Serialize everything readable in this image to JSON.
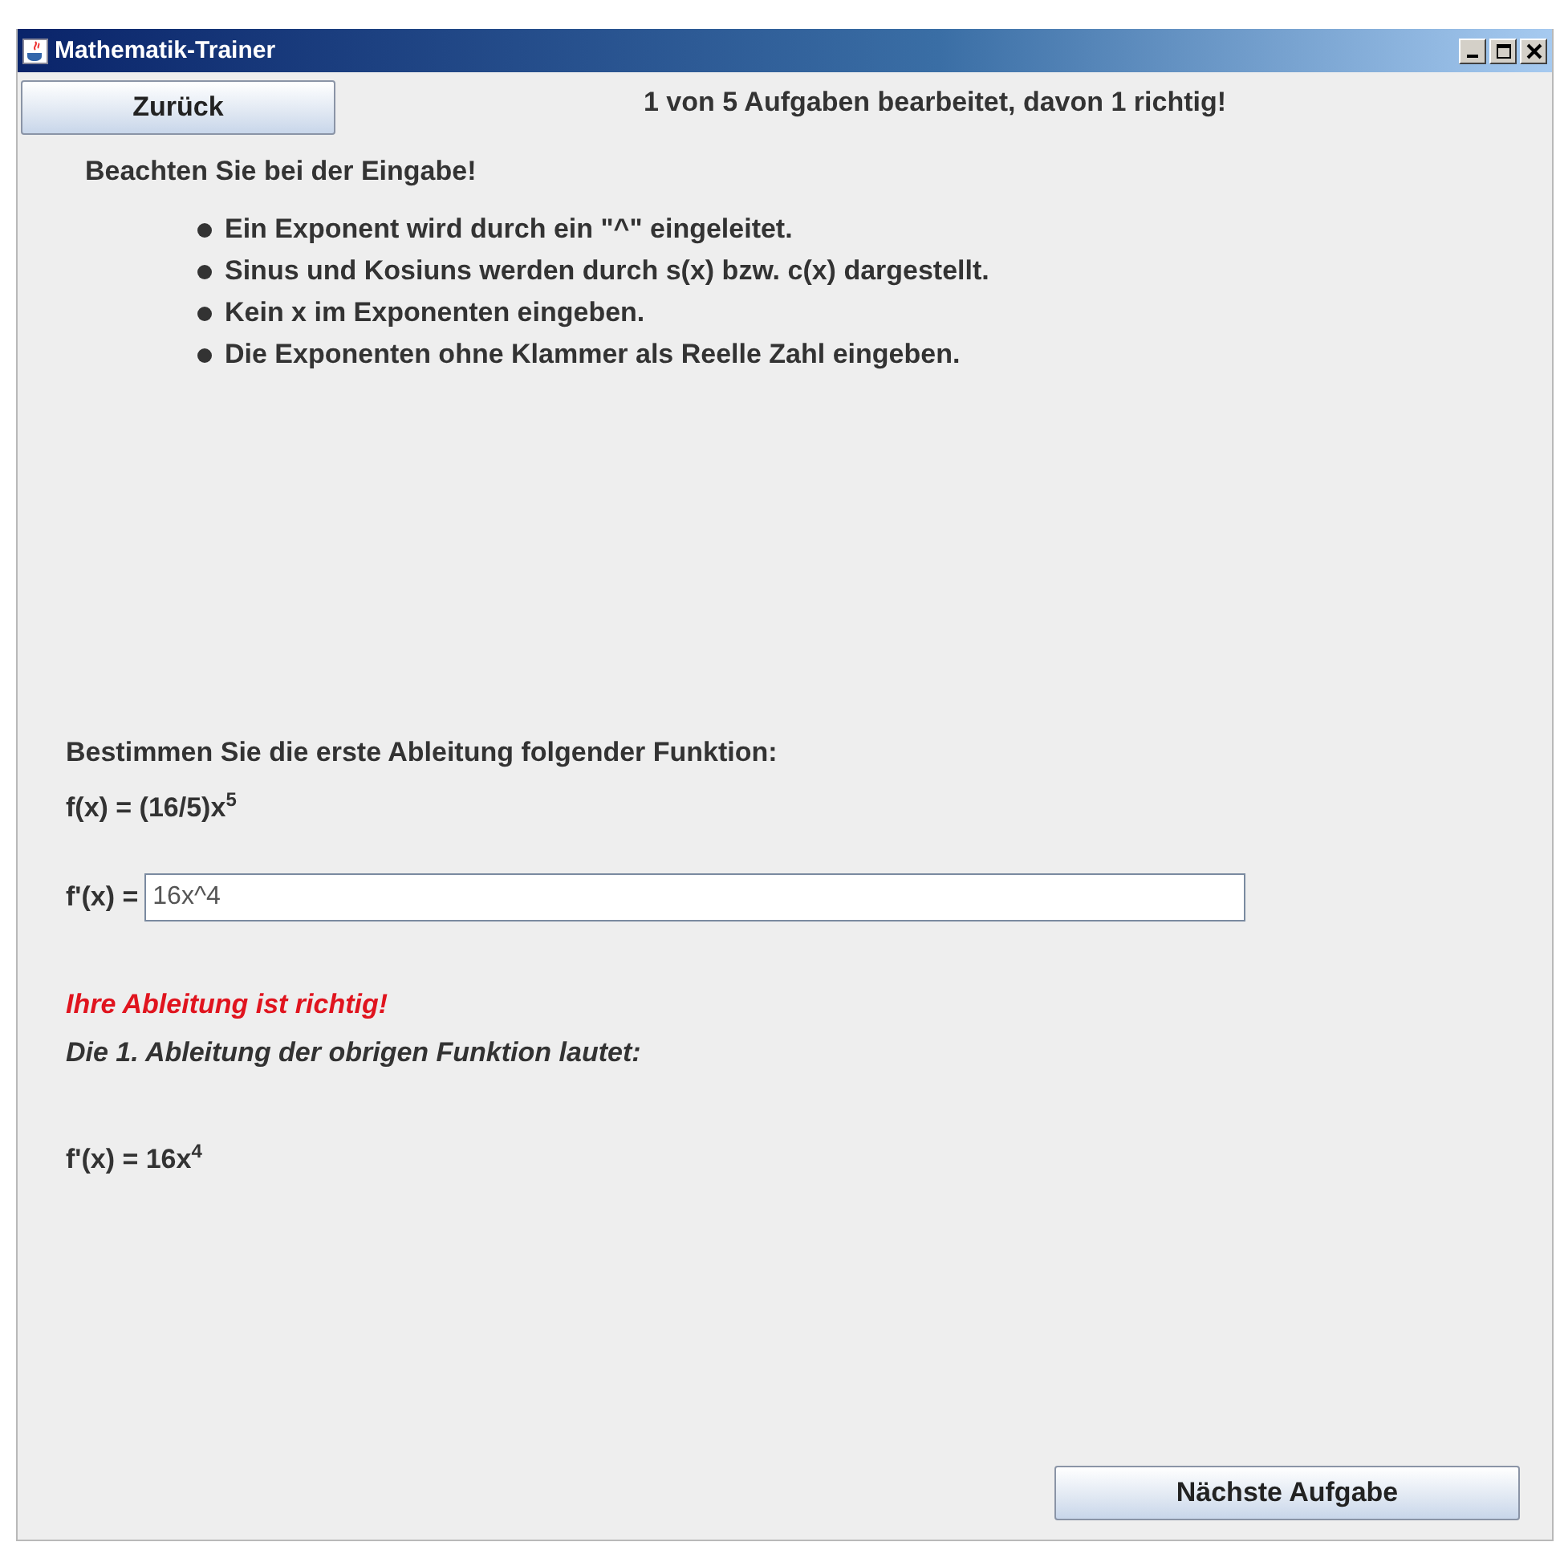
{
  "window": {
    "title": "Mathematik-Trainer"
  },
  "back_button": "Zurück",
  "progress": "1 von 5 Aufgaben bearbeitet, davon 1 richtig!",
  "hints_title": "Beachten Sie bei der Eingabe!",
  "hints": [
    "Ein Exponent wird durch ein \"^\" eingeleitet.",
    "Sinus und Kosiuns werden durch s(x) bzw. c(x) dargestellt.",
    "Kein x im Exponenten eingeben.",
    "Die Exponenten ohne Klammer als Reelle Zahl eingeben."
  ],
  "task": "Bestimmen Sie die erste Ableitung folgender Funktion:",
  "function": "f(x) = (16/5)x$^{5}$",
  "answer": {
    "label": "f'(x) =",
    "value": "16x^4"
  },
  "feedback": "Ihre Ableitung ist richtig!",
  "solution_intro": "Die 1. Ableitung der obrigen Funktion lautet:",
  "solution": "f'(x) = 16x$^{4}$",
  "next_button": "Nächste Aufgabe"
}
